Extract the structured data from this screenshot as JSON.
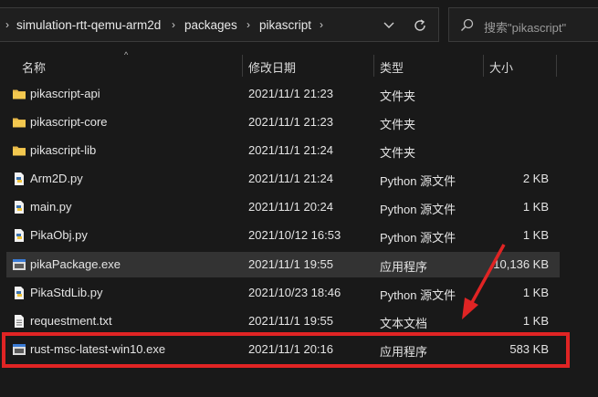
{
  "address": {
    "crumbs": [
      "simulation-rtt-qemu-arm2d",
      "packages",
      "pikascript"
    ]
  },
  "search": {
    "placeholder": "搜索\"pikascript\""
  },
  "columns": {
    "name": "名称",
    "date": "修改日期",
    "type": "类型",
    "size": "大小"
  },
  "files": [
    {
      "name": "pikascript-api",
      "date": "2021/11/1 21:23",
      "type": "文件夹",
      "size": "",
      "icon": "folder-icon"
    },
    {
      "name": "pikascript-core",
      "date": "2021/11/1 21:23",
      "type": "文件夹",
      "size": "",
      "icon": "folder-icon"
    },
    {
      "name": "pikascript-lib",
      "date": "2021/11/1 21:24",
      "type": "文件夹",
      "size": "",
      "icon": "folder-icon"
    },
    {
      "name": "Arm2D.py",
      "date": "2021/11/1 21:24",
      "type": "Python 源文件",
      "size": "2 KB",
      "icon": "python-file-icon"
    },
    {
      "name": "main.py",
      "date": "2021/11/1 20:24",
      "type": "Python 源文件",
      "size": "1 KB",
      "icon": "python-file-icon"
    },
    {
      "name": "PikaObj.py",
      "date": "2021/10/12 16:53",
      "type": "Python 源文件",
      "size": "1 KB",
      "icon": "python-file-icon"
    },
    {
      "name": "pikaPackage.exe",
      "date": "2021/11/1 19:55",
      "type": "应用程序",
      "size": "10,136 KB",
      "icon": "exe-file-icon"
    },
    {
      "name": "PikaStdLib.py",
      "date": "2021/10/23 18:46",
      "type": "Python 源文件",
      "size": "1 KB",
      "icon": "python-file-icon"
    },
    {
      "name": "requestment.txt",
      "date": "2021/11/1 19:55",
      "type": "文本文档",
      "size": "1 KB",
      "icon": "text-file-icon"
    },
    {
      "name": "rust-msc-latest-win10.exe",
      "date": "2021/11/1 20:16",
      "type": "应用程序",
      "size": "583 KB",
      "icon": "exe-file-icon"
    }
  ],
  "colors": {
    "highlight": "#e02424",
    "background": "#191919",
    "selected_row": "#333333"
  }
}
